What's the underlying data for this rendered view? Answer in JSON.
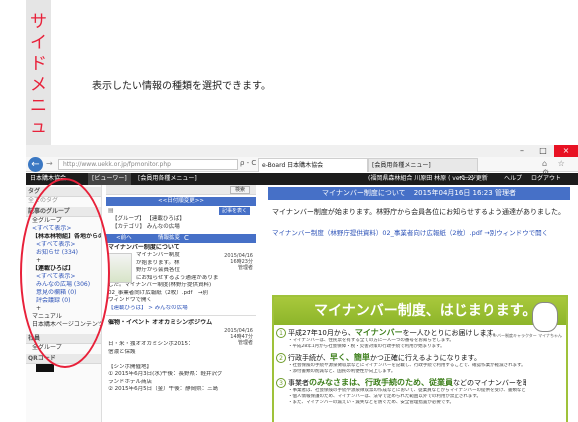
{
  "annotation": {
    "vertical_title": "サイドメニュー",
    "caption": "表示したい情報の種類を選択できます。"
  },
  "browser": {
    "window_controls": {
      "minimize": "–",
      "maximize": "□",
      "close": "×"
    },
    "address": "http://www.uekk.or.jp/fpmonitor.php",
    "address_icons": "ρ - C",
    "tabs": [
      "e-Board 日本購木協会",
      "[会員用各種メニュー]"
    ],
    "tools": "⌂ ☆ ⚙"
  },
  "menubar": {
    "home": "日本購木協会",
    "viewer": "[ビューワー]",
    "members": "[会員用各種メニュー]",
    "user": "(福岡県森林組合 川原田 林原 ( ver1.2)",
    "page_update": "ページ更新",
    "help": "ヘルプ",
    "logout": "ログアウト"
  },
  "sidebar": {
    "header": "タグ",
    "all_tags": "全てのタグ",
    "group_header": "記事のグループ",
    "all_groups": "全グループ",
    "show_all_1": "<すべて表示>",
    "notice_group": "【林本林物組】各地からのお知らせ",
    "show_all_2": "<すべて表示>",
    "notice_count": "お知らせ (334)",
    "plus": "+",
    "plaza": "【連載ひろば】",
    "show_all_3": "<すべて表示>",
    "everyone_plaza": "みんなの広場 (306)",
    "opinion_box": "意見の欄箱 (0)",
    "minutes": "評会議録 (0)",
    "manual": "マニュアル",
    "homepage": "日本購木ページコンテンツ",
    "company_header": "社員",
    "all_groups_2": "全グループ",
    "qr_header": "QRコード"
  },
  "middle": {
    "search": "検索",
    "date_order": "<<日付順変更>>",
    "filter_btn": "記事を表く",
    "filter_group": "【グループ】 【連載ひろば】",
    "filter_category": "【カテゴリ】 みんなの広場",
    "prev": "<前へ",
    "detail": "情報拡変",
    "refresh": "C",
    "post1": {
      "title": "マイナンバー制度について",
      "date": "2015/04/16",
      "time": "16時23分",
      "author": "管理者",
      "body_lines": [
        "マイナンバー制度",
        "が始まります。林",
        "野庁から会員各位",
        "にお知らせするよう通達がありま"
      ],
      "body_full": "した。マイナンバー制度(林野庁提供資料)",
      "attach": "02_事業者向け広報紙（2枚）.pdf　→別",
      "attach2": "ウィンドウで開く",
      "link": "【連載ひろば】 > みんなの広場"
    },
    "post2": {
      "title": "催物・イベント オオカミシンポジウム",
      "date": "2015/04/16",
      "time": "14時47分",
      "author": "管理者",
      "body_lines": [
        "日・米・独オオカミシンポ2015：",
        "信濃と保護",
        "",
        "【シンポ開催地】",
        "① 2015年6月3日(水)午後：長野県：軽井沢グ",
        "ランドホテル商店",
        "② 2015年6月5日（金）午後：静岡県：三島"
      ]
    }
  },
  "main": {
    "title": "マイナンバー制度について",
    "date": "2015年04月16日 16:23 管理者",
    "text": "マイナンバー制度が始まります。林野庁から会員各位にお知らせするよう通達がありました。",
    "link": "マイナンバー制度（林野庁提供資料）02_事業者向け広報紙（2枚）.pdf",
    "new_window": "→別ウィンドウで開く",
    "doc": {
      "banner": "マイナンバー制度、はじまります。",
      "mascot_label": "マイナンバー制度キャラクター マイナちゃん",
      "sections": [
        {
          "num": "1",
          "heading_pre": "平成27年10月から、",
          "heading_em": "マイナンバー",
          "heading_post": "を一人ひとりにお届けします。",
          "lines": [
            "・マイナンバーは、住民票を有する全ての方に一人一つの番号をお知らせします。",
            "・平成28年1月から社会保障・税・災害対策の行政手続で利用が始まります。"
          ]
        },
        {
          "num": "2",
          "heading_pre": "行政手続が、",
          "heading_em": "早く、簡単",
          "heading_post": "かつ正確に行えるようになります。",
          "lines": [
            "・社会保険の手続や源泉徴収票などにマイナンバーを記載し、行政手続で利用することで、確認作業が軽減されます。",
            "・添付書類の削減など、国民の利便性が向上します。"
          ]
        },
        {
          "num": "3",
          "heading_pre": "事業者",
          "heading_em": "のみなさまは、行政手続のため、従業員",
          "heading_post": "などのマイナンバーを取り扱います。",
          "lines": [
            "・事業者は、社会保険の手続や源泉徴収票の作成などにおいて、従業員などからマイナンバーの提供を受け、書類などに記載します。",
            "・個人情報保護のため、マイナンバーは、法令で定められた範囲以外での利用が禁止されます。",
            "・また、マイナンバーの漏えい・滅失などを防ぐため、安全管理措置が必要です。"
          ]
        }
      ]
    }
  }
}
